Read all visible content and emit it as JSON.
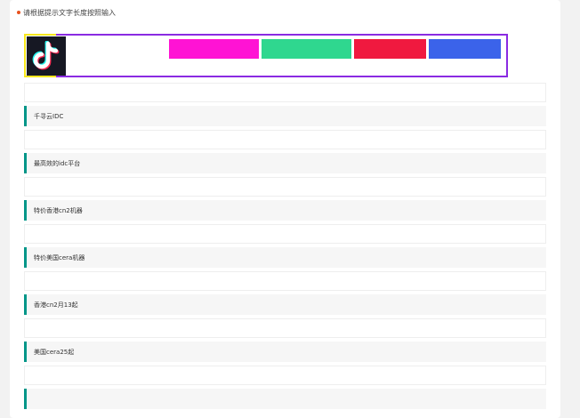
{
  "hint": {
    "text": "请根据提示文字长度按照输入"
  },
  "banner": {
    "logo_icon": "tiktok-logo-icon",
    "swatches": [
      "#ff13d4",
      "#2fd78f",
      "#f0193f",
      "#3b63ea"
    ]
  },
  "links": [
    "千寻云IDC",
    "最高效的idc平台",
    "特价香港cn2机器",
    "特价美国cera机器",
    "香港cn2月13起",
    "美国cera25起"
  ],
  "colors": {
    "accent": "#009688",
    "hint_dot": "#e8521e",
    "frame_yellow": "#f8e71c",
    "frame_purple": "#8a2be2"
  }
}
